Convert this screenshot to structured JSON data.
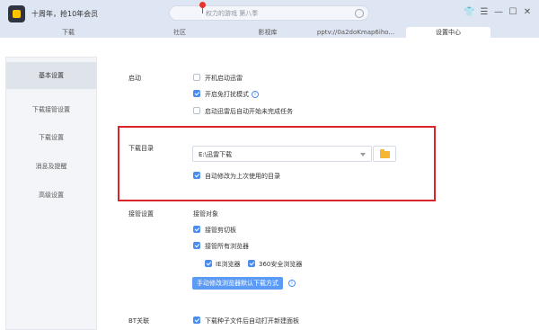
{
  "titlebar": {
    "promo_text": "十周年，抢10年会员",
    "search_placeholder": "权力的游戏 第八季",
    "back_glyph": "‹",
    "forward_glyph": "›",
    "controls": [
      "shirt-icon",
      "menu-icon",
      "minimize-icon",
      "maximize-icon",
      "close-icon"
    ],
    "control_glyphs": [
      "👕",
      "☰",
      "—",
      "☐",
      "✕"
    ]
  },
  "tabs": [
    {
      "label": "下载"
    },
    {
      "label": "社区"
    },
    {
      "label": "影视库"
    },
    {
      "label": "pptv://0a2doKmap6iho..."
    },
    {
      "label": "设置中心"
    }
  ],
  "sidebar": {
    "items": [
      {
        "label": "基本设置"
      },
      {
        "label": "下载接管设置"
      },
      {
        "label": "下载设置"
      },
      {
        "label": "消息及提醒"
      },
      {
        "label": "高级设置"
      }
    ]
  },
  "startup": {
    "label": "启动",
    "options": [
      {
        "label": "开机启动迅雷",
        "checked": false
      },
      {
        "label": "开启免打扰模式",
        "checked": true
      },
      {
        "label": "启动迅雷后自动开始未完成任务",
        "checked": false
      }
    ]
  },
  "download_dir": {
    "label": "下载目录",
    "path": "E:\\迅雷下载",
    "auto_modify_label": "自动修改为上次使用的目录",
    "auto_modify_checked": true
  },
  "takeover": {
    "label": "接管设置",
    "target_label": "接管对象",
    "clipboard_label": "接管剪切板",
    "all_browsers_label": "接管所有浏览器",
    "ie_label": "IE浏览器",
    "browser360_label": "360安全浏览器",
    "fix_button_label": "手动修改浏览器默认下载方式"
  },
  "bt": {
    "label": "BT关联",
    "option_label": "下载种子文件后自动打开新建面板"
  },
  "colors": {
    "accent": "#4a8cf0",
    "highlight_border": "#d8262a",
    "titlebar_bg": "#dfe6f3"
  }
}
